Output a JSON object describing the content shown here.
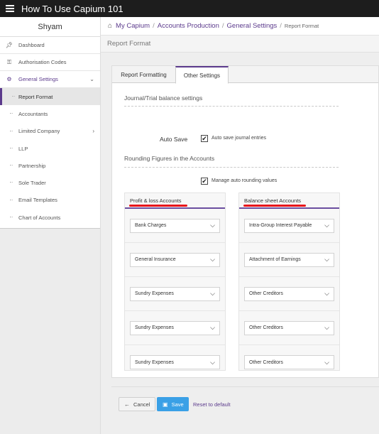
{
  "app": {
    "title": "How To Use Capium 101",
    "user_name": "Shyam"
  },
  "sidebar": {
    "items": [
      {
        "label": "Dashboard",
        "icon": "pin-icon"
      },
      {
        "label": "Authorisation Codes",
        "icon": "key-icon"
      },
      {
        "label": "General Settings",
        "icon": "gears-icon"
      }
    ],
    "sub_items": [
      "Report Format",
      "Accountants",
      "Limited Company",
      "LLP",
      "Partnership",
      "Sole Trader",
      "Email Templates",
      "Chart of Accounts"
    ]
  },
  "breadcrumb": {
    "items": [
      "My Capium",
      "Accounts Production",
      "General Settings"
    ],
    "current": "Report Format",
    "sep": "/"
  },
  "page": {
    "title": "Report Format"
  },
  "tabs": [
    "Report Formatting",
    "Other Settings"
  ],
  "settings": {
    "journal_title": "Journal/Trial balance settings",
    "auto_save_label": "Auto Save",
    "auto_save_text": "Auto save journal entries",
    "auto_save_checked": true,
    "rounding_title": "Rounding Figures in the Accounts",
    "manage_rounding_text": "Manage auto rounding values",
    "manage_rounding_checked": true
  },
  "profit_loss": {
    "title": "Profit & loss Accounts",
    "selects": [
      "Bank Charges",
      "General Insurance",
      "Sundry Expenses",
      "Sundry Expenses",
      "Sundry Expenses"
    ]
  },
  "balance_sheet": {
    "title": "Balance sheet Accounts",
    "selects": [
      "Intra-Group Interest Payable",
      "Attachment of Earnings",
      "Other Creditors",
      "Other Creditors",
      "Other Creditors"
    ]
  },
  "footer": {
    "cancel_label": "Cancel",
    "save_label": "Save",
    "reset_label": "Reset to default"
  },
  "colors": {
    "accent": "#5b3a8c",
    "save": "#3aa0e6",
    "annotation": "#e8131a"
  }
}
